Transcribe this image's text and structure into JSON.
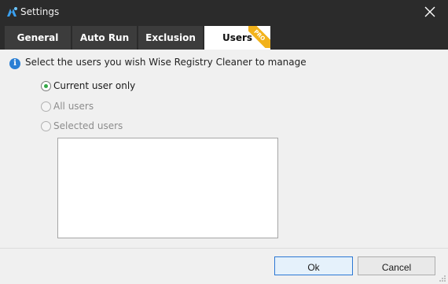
{
  "window": {
    "title": "Settings"
  },
  "tabs": [
    {
      "label": "General",
      "active": false
    },
    {
      "label": "Auto Run",
      "active": false
    },
    {
      "label": "Exclusion",
      "active": false
    },
    {
      "label": "Users",
      "active": true,
      "badge": "PRO"
    }
  ],
  "info": {
    "text": "Select the users you wish Wise Registry Cleaner to manage"
  },
  "options": [
    {
      "label": "Current user only",
      "checked": true,
      "enabled": true
    },
    {
      "label": "All users",
      "checked": false,
      "enabled": false
    },
    {
      "label": "Selected users",
      "checked": false,
      "enabled": false
    }
  ],
  "buttons": {
    "ok": "Ok",
    "cancel": "Cancel"
  },
  "colors": {
    "titlebar": "#2b2b2b",
    "tab": "#3c3c3c",
    "accent": "#2c78d4",
    "radio_checked": "#33a847",
    "pro_badge": "#f2b21a"
  }
}
